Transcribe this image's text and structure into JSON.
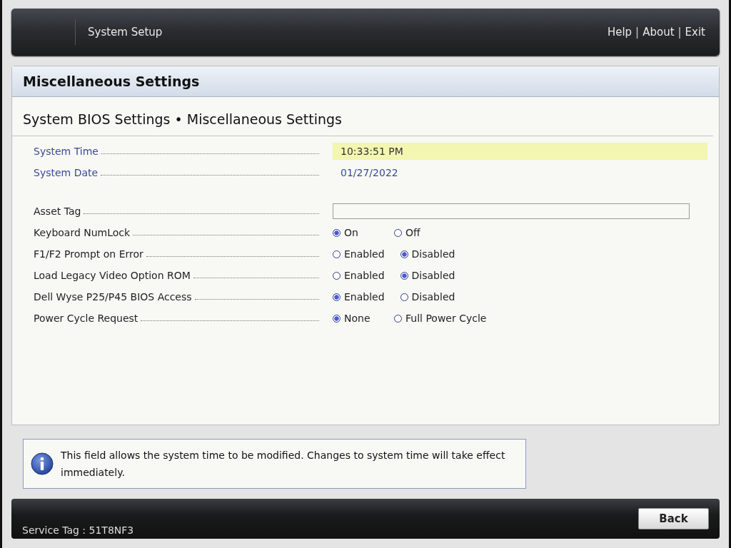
{
  "header": {
    "title": "System Setup",
    "links": [
      "Help",
      "About",
      "Exit"
    ],
    "separator": "|"
  },
  "panel": {
    "title": "Miscellaneous Settings",
    "breadcrumb": "System BIOS Settings • Miscellaneous Settings"
  },
  "groups": [
    [
      {
        "kind": "value",
        "label": "System Time",
        "value": "10:33:51 PM",
        "focused": true
      },
      {
        "kind": "value",
        "label": "System Date",
        "value": "01/27/2022",
        "focused": false
      }
    ],
    [
      {
        "kind": "field",
        "label": "Asset Tag"
      },
      {
        "kind": "radio",
        "label": "Keyboard NumLock",
        "options": [
          {
            "label": "On",
            "selected": true
          },
          {
            "label": "Off",
            "selected": false
          }
        ]
      },
      {
        "kind": "radio",
        "label": "F1/F2 Prompt on Error",
        "options": [
          {
            "label": "Enabled",
            "selected": false
          },
          {
            "label": "Disabled",
            "selected": true
          }
        ]
      },
      {
        "kind": "radio",
        "label": "Load Legacy Video Option ROM",
        "options": [
          {
            "label": "Enabled",
            "selected": false
          },
          {
            "label": "Disabled",
            "selected": true
          }
        ]
      },
      {
        "kind": "radio",
        "label": "Dell Wyse P25/P45 BIOS Access",
        "options": [
          {
            "label": "Enabled",
            "selected": true
          },
          {
            "label": "Disabled",
            "selected": false
          }
        ]
      },
      {
        "kind": "radio",
        "label": "Power Cycle Request",
        "options": [
          {
            "label": "None",
            "selected": true
          },
          {
            "label": "Full Power Cycle",
            "selected": false
          }
        ]
      }
    ]
  ],
  "info": {
    "text": "This field allows the system time to be modified. Changes to system time will take effect immediately."
  },
  "footer": {
    "service_tag": "Service Tag : 51T8NF3",
    "button": "Back"
  }
}
